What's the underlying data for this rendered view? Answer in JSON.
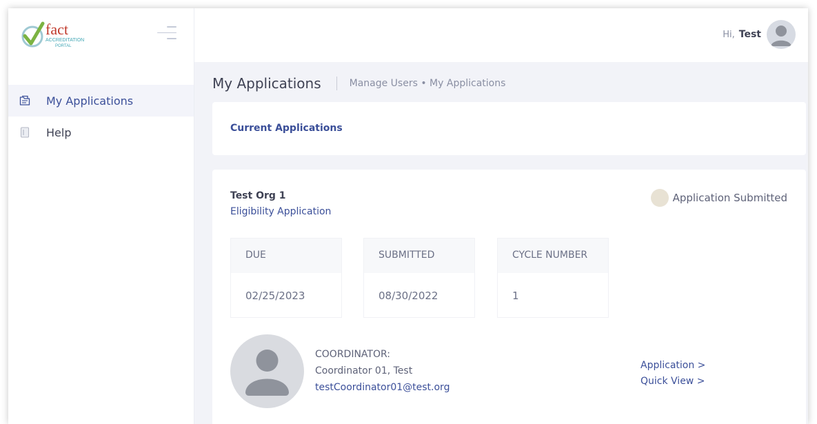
{
  "brand": {
    "logo_word": "fact",
    "logo_line1": "ACCREDITATION",
    "logo_line2": "PORTAL",
    "colors": {
      "primary": "#3b4f99",
      "logo_red": "#c0392b",
      "logo_green": "#7cb342",
      "logo_teal": "#41a6b5"
    }
  },
  "sidebar": {
    "items": [
      {
        "label": "My Applications",
        "icon": "application-folder-icon",
        "active": true
      },
      {
        "label": "Help",
        "icon": "help-book-icon",
        "active": false
      }
    ]
  },
  "topbar": {
    "greeting": "Hi,",
    "user_name": "Test",
    "avatar_icon": "user-avatar-icon"
  },
  "subheader": {
    "title": "My Applications",
    "breadcrumb": "Manage Users • My Applications"
  },
  "current": {
    "title": "Current Applications"
  },
  "application": {
    "org": "Test Org 1",
    "type": "Eligibility Application",
    "status": "Application Submitted",
    "stats": [
      {
        "label": "DUE",
        "value": "02/25/2023"
      },
      {
        "label": "SUBMITTED",
        "value": "08/30/2022"
      },
      {
        "label": "CYCLE NUMBER",
        "value": "1"
      }
    ],
    "coordinator_label": "COORDINATOR:",
    "coordinator_name": "Coordinator 01, Test",
    "coordinator_email": "testCoordinator01@test.org",
    "links": [
      "Application >",
      "Quick View >"
    ]
  }
}
